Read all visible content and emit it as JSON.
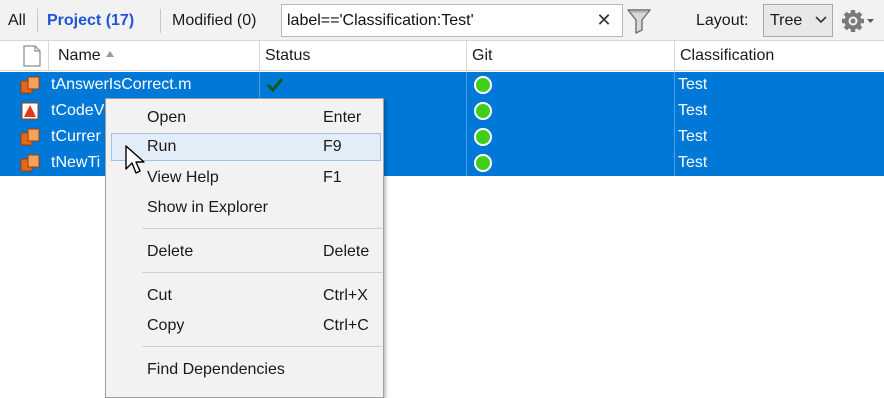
{
  "toolbar": {
    "tab_all": "All",
    "tab_project": "Project (17)",
    "tab_modified": "Modified (0)",
    "search_value": "label=='Classification:Test'",
    "clear_icon": "close-icon",
    "filter_icon": "filter-icon",
    "layout_label": "Layout:",
    "layout_value": "Tree",
    "gear_icon": "gear-icon"
  },
  "table": {
    "headers": {
      "name": "Name",
      "status": "Status",
      "git": "Git",
      "classification": "Classification"
    },
    "rows": [
      {
        "name": "tAnswerIsCorrect.m",
        "status": "passed",
        "git": "unmodified",
        "classification": "Test"
      },
      {
        "name": "tCodeV",
        "status": "",
        "git": "unmodified",
        "classification": "Test"
      },
      {
        "name": "tCurrer",
        "status": "",
        "git": "unmodified",
        "classification": "Test"
      },
      {
        "name": "tNewTi",
        "status": "",
        "git": "unmodified",
        "classification": "Test"
      }
    ]
  },
  "context_menu": {
    "items": [
      {
        "label": "Open",
        "shortcut": "Enter"
      },
      {
        "label": "Run",
        "shortcut": "F9"
      },
      {
        "label": "View Help",
        "shortcut": "F1"
      },
      {
        "label": "Show in Explorer",
        "shortcut": ""
      },
      {
        "label": "Delete",
        "shortcut": "Delete"
      },
      {
        "label": "Cut",
        "shortcut": "Ctrl+X"
      },
      {
        "label": "Copy",
        "shortcut": "Ctrl+C"
      },
      {
        "label": "Find Dependencies",
        "shortcut": ""
      }
    ]
  },
  "colors": {
    "selection": "#0078d7",
    "active_tab": "#1f55d6",
    "git_ok": "#3fcf1c",
    "menu_bg": "#f2f2f2",
    "menu_hover": "#e3edf7"
  }
}
